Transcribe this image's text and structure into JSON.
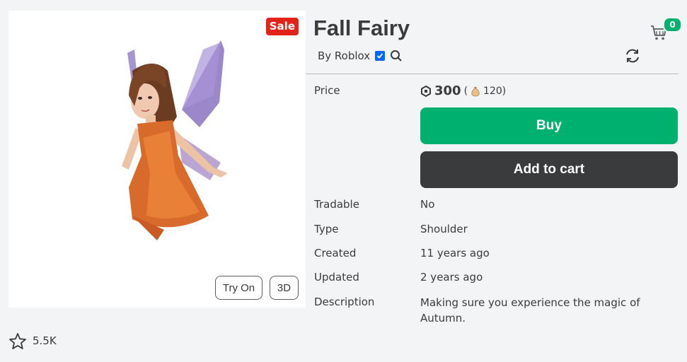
{
  "thumbnail": {
    "sale_badge": "Sale",
    "try_on_label": "Try On",
    "three_d_label": "3D"
  },
  "favorites": {
    "count": "5.5K"
  },
  "item": {
    "title": "Fall Fairy",
    "creator": "By Roblox",
    "cart_count": "0"
  },
  "price": {
    "label": "Price",
    "amount": "300",
    "secondary_open": "(",
    "secondary_amount": "120)"
  },
  "actions": {
    "buy_label": "Buy",
    "add_to_cart_label": "Add to cart"
  },
  "details": [
    {
      "label": "Tradable",
      "value": "No"
    },
    {
      "label": "Type",
      "value": "Shoulder"
    },
    {
      "label": "Created",
      "value": "11 years ago"
    },
    {
      "label": "Updated",
      "value": "2 years ago"
    },
    {
      "label": "Description",
      "value": "Making sure you experience the magic of Autumn."
    }
  ],
  "colors": {
    "buy_green": "#00b06f",
    "cart_dark": "#393b3d",
    "sale_red": "#e2231a",
    "verified_blue": "#0066ff"
  },
  "icons": {
    "cart": "shopping-cart-icon",
    "refresh": "refresh-icon",
    "verified": "verified-badge-icon",
    "search": "search-icon",
    "robux": "robux-icon",
    "moneybag": "money-bag-icon",
    "star": "star-outline-icon"
  }
}
